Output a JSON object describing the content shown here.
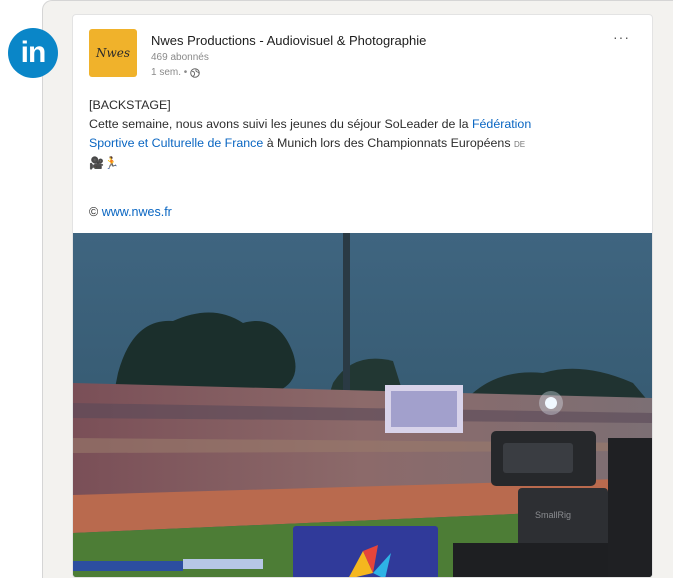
{
  "brand": {
    "badge_text": "in",
    "color": "#0a86c8"
  },
  "post": {
    "author": "Nwes Productions - Audiovisuel & Photographie",
    "logo_text": "Nwes",
    "followers": "469 abonnés",
    "time": "1 sem. •",
    "more_label": "···",
    "text_tag": "[BACKSTAGE]",
    "text_a": "Cette semaine, nous avons suivi les jeunes du séjour SoLeader de la ",
    "text_link1": "Fédération",
    "text_link2": "Sportive et Culturelle de France",
    "text_b": " à Munich lors des Championnats Européens",
    "see_more": "DE",
    "emojis": "🎥🏃",
    "copyright": "© ",
    "website": "www.nwes.fr",
    "camera_brand": "SmallRig",
    "link_color": "#0a66c2"
  }
}
